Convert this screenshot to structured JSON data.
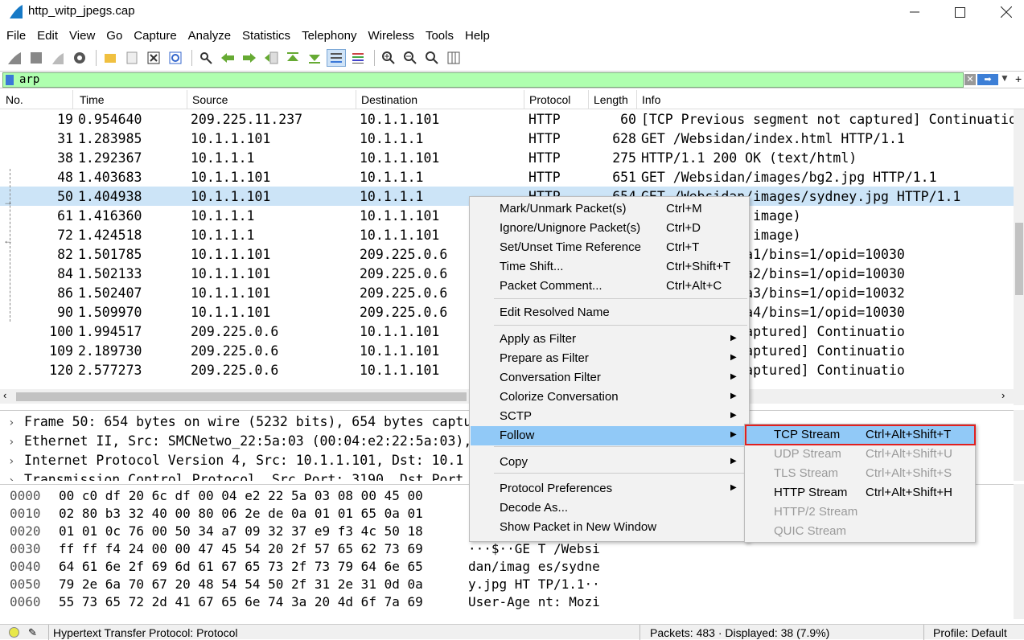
{
  "window": {
    "title": "http_witp_jpegs.cap"
  },
  "menubar": [
    "File",
    "Edit",
    "View",
    "Go",
    "Capture",
    "Analyze",
    "Statistics",
    "Telephony",
    "Wireless",
    "Tools",
    "Help"
  ],
  "filter": {
    "value": "arp"
  },
  "columns": [
    "No.",
    "Time",
    "Source",
    "Destination",
    "Protocol",
    "Length",
    "Info"
  ],
  "packets": [
    {
      "no": "19",
      "time": "0.954640",
      "src": "209.225.11.237",
      "dst": "10.1.1.101",
      "proto": "HTTP",
      "len": "60",
      "info": "[TCP Previous segment not captured] Continuatio"
    },
    {
      "no": "31",
      "time": "1.283985",
      "src": "10.1.1.101",
      "dst": "10.1.1.1",
      "proto": "HTTP",
      "len": "628",
      "info": "GET /Websidan/index.html HTTP/1.1"
    },
    {
      "no": "38",
      "time": "1.292367",
      "src": "10.1.1.1",
      "dst": "10.1.1.101",
      "proto": "HTTP",
      "len": "275",
      "info": "HTTP/1.1 200 OK  (text/html)"
    },
    {
      "no": "48",
      "time": "1.403683",
      "src": "10.1.1.101",
      "dst": "10.1.1.1",
      "proto": "HTTP",
      "len": "651",
      "info": "GET /Websidan/images/bg2.jpg HTTP/1.1"
    },
    {
      "no": "50",
      "time": "1.404938",
      "src": "10.1.1.101",
      "dst": "10.1.1.1",
      "proto": "HTTP",
      "len": "654",
      "info": "GET /Websidan/images/sydney.jpg HTTP/1.1"
    },
    {
      "no": "61",
      "time": "1.416360",
      "src": "10.1.1.1",
      "dst": "10.1.1.101",
      "proto": "",
      "len": "",
      "info": "OK  (JPEG JFIF image)"
    },
    {
      "no": "72",
      "time": "1.424518",
      "src": "10.1.1.1",
      "dst": "10.1.1.101",
      "proto": "",
      "len": "",
      "info": "OK  (JPEG JFIF image)"
    },
    {
      "no": "82",
      "time": "1.501785",
      "src": "10.1.1.101",
      "dst": "209.225.0.6",
      "proto": "",
      "len": "",
      "info": "385/bnum=opera1/bins=1/opid=10030"
    },
    {
      "no": "84",
      "time": "1.502133",
      "src": "10.1.1.101",
      "dst": "209.225.0.6",
      "proto": "",
      "len": "",
      "info": "385/bnum=opera2/bins=1/opid=10030"
    },
    {
      "no": "86",
      "time": "1.502407",
      "src": "10.1.1.101",
      "dst": "209.225.0.6",
      "proto": "",
      "len": "",
      "info": "385/bnum=opera3/bins=1/opid=10032"
    },
    {
      "no": "90",
      "time": "1.509970",
      "src": "10.1.1.101",
      "dst": "209.225.0.6",
      "proto": "",
      "len": "",
      "info": "385/bnum=opera4/bins=1/opid=10030"
    },
    {
      "no": "100",
      "time": "1.994517",
      "src": "209.225.0.6",
      "dst": "10.1.1.101",
      "proto": "",
      "len": "",
      "info": "segment not captured] Continuatio"
    },
    {
      "no": "109",
      "time": "2.189730",
      "src": "209.225.0.6",
      "dst": "10.1.1.101",
      "proto": "",
      "len": "",
      "info": "segment not captured] Continuatio"
    },
    {
      "no": "120",
      "time": "2.577273",
      "src": "209.225.0.6",
      "dst": "10.1.1.101",
      "proto": "",
      "len": "",
      "info": "segment not captured] Continuatio"
    }
  ],
  "details": [
    "Frame 50: 654 bytes on wire (5232 bits), 654 bytes captu",
    "Ethernet II, Src: SMCNetwo_22:5a:03 (00:04:e2:22:5a:03),",
    "Internet Protocol Version 4, Src: 10.1.1.101, Dst: 10.1",
    "Transmission Control Protocol, Src Port: 3190, Dst Port"
  ],
  "bytes": [
    {
      "off": "0000",
      "hex": "00 c0 df 20 6c df 00 04  e2 22 5a 03 08 00 45 00",
      "asc": ""
    },
    {
      "off": "0010",
      "hex": "02 80 b3 32 40 00 80 06  2e de 0a 01 01 65 0a 01",
      "asc": ""
    },
    {
      "off": "0020",
      "hex": "01 01 0c 76 00 50 34 a7  09 32 37 e9 f3 4c 50 18",
      "asc": ""
    },
    {
      "off": "0030",
      "hex": "ff ff f4 24 00 00 47 45  54 20 2f 57 65 62 73 69",
      "asc": "···$··GE T /Websi"
    },
    {
      "off": "0040",
      "hex": "64 61 6e 2f 69 6d 61 67  65 73 2f 73 79 64 6e 65",
      "asc": "dan/imag es/sydne"
    },
    {
      "off": "0050",
      "hex": "79 2e 6a 70 67 20 48 54  54 50 2f 31 2e 31 0d 0a",
      "asc": "y.jpg HT TP/1.1··"
    },
    {
      "off": "0060",
      "hex": "55 73 65 72 2d 41 67 65  6e 74 3a 20 4d 6f 7a 69",
      "asc": "User-Age nt: Mozi"
    }
  ],
  "status": {
    "left": "Hypertext Transfer Protocol: Protocol",
    "packets": "Packets: 483 · Displayed: 38 (7.9%)",
    "profile": "Profile: Default"
  },
  "context_menu": [
    {
      "label": "Mark/Unmark Packet(s)",
      "shortcut": "Ctrl+M"
    },
    {
      "label": "Ignore/Unignore Packet(s)",
      "shortcut": "Ctrl+D"
    },
    {
      "label": "Set/Unset Time Reference",
      "shortcut": "Ctrl+T"
    },
    {
      "label": "Time Shift...",
      "shortcut": "Ctrl+Shift+T"
    },
    {
      "label": "Packet Comment...",
      "shortcut": "Ctrl+Alt+C"
    },
    {
      "label": "Edit Resolved Name",
      "shortcut": ""
    },
    {
      "label": "Apply as Filter",
      "shortcut": ""
    },
    {
      "label": "Prepare as Filter",
      "shortcut": ""
    },
    {
      "label": "Conversation Filter",
      "shortcut": ""
    },
    {
      "label": "Colorize Conversation",
      "shortcut": ""
    },
    {
      "label": "SCTP",
      "shortcut": ""
    },
    {
      "label": "Follow",
      "shortcut": ""
    },
    {
      "label": "Copy",
      "shortcut": ""
    },
    {
      "label": "Protocol Preferences",
      "shortcut": ""
    },
    {
      "label": "Decode As...",
      "shortcut": ""
    },
    {
      "label": "Show Packet in New Window",
      "shortcut": ""
    }
  ],
  "follow_submenu": [
    {
      "label": "TCP Stream",
      "shortcut": "Ctrl+Alt+Shift+T"
    },
    {
      "label": "UDP Stream",
      "shortcut": "Ctrl+Alt+Shift+U"
    },
    {
      "label": "TLS Stream",
      "shortcut": "Ctrl+Alt+Shift+S"
    },
    {
      "label": "HTTP Stream",
      "shortcut": "Ctrl+Alt+Shift+H"
    },
    {
      "label": "HTTP/2 Stream",
      "shortcut": ""
    },
    {
      "label": "QUIC Stream",
      "shortcut": ""
    }
  ],
  "colors": {
    "filter_bg": "#afffaf",
    "selected_row": "#cce4f7",
    "menu_highlight": "#91c9f7",
    "annotation_box": "#e02020"
  }
}
